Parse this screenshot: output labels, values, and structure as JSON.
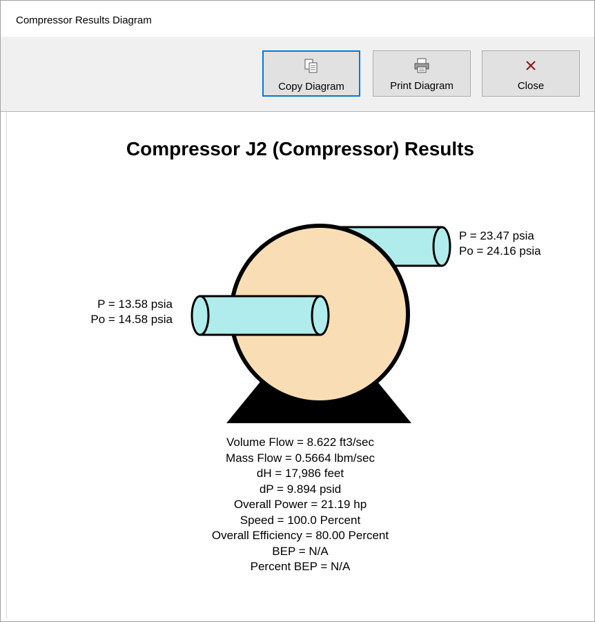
{
  "window": {
    "title": "Compressor Results Diagram"
  },
  "toolbar": {
    "copy_label": "Copy Diagram",
    "print_label": "Print Diagram",
    "close_label": "Close"
  },
  "diagram": {
    "title": "Compressor J2 (Compressor) Results",
    "inlet": {
      "p": "P = 13.58 psia",
      "po": "Po = 14.58 psia"
    },
    "outlet": {
      "p": "P = 23.47 psia",
      "po": "Po = 24.16 psia"
    },
    "results": [
      "Volume Flow = 8.622 ft3/sec",
      "Mass Flow = 0.5664 lbm/sec",
      "dH = 17,986 feet",
      "dP = 9.894 psid",
      "Overall Power = 21.19 hp",
      "Speed = 100.0 Percent",
      "Overall Efficiency = 80.00 Percent",
      "BEP = N/A",
      "Percent BEP = N/A"
    ],
    "colors": {
      "casing": "#f9deb5",
      "pipe": "#b0ecec",
      "base": "#000000"
    }
  }
}
